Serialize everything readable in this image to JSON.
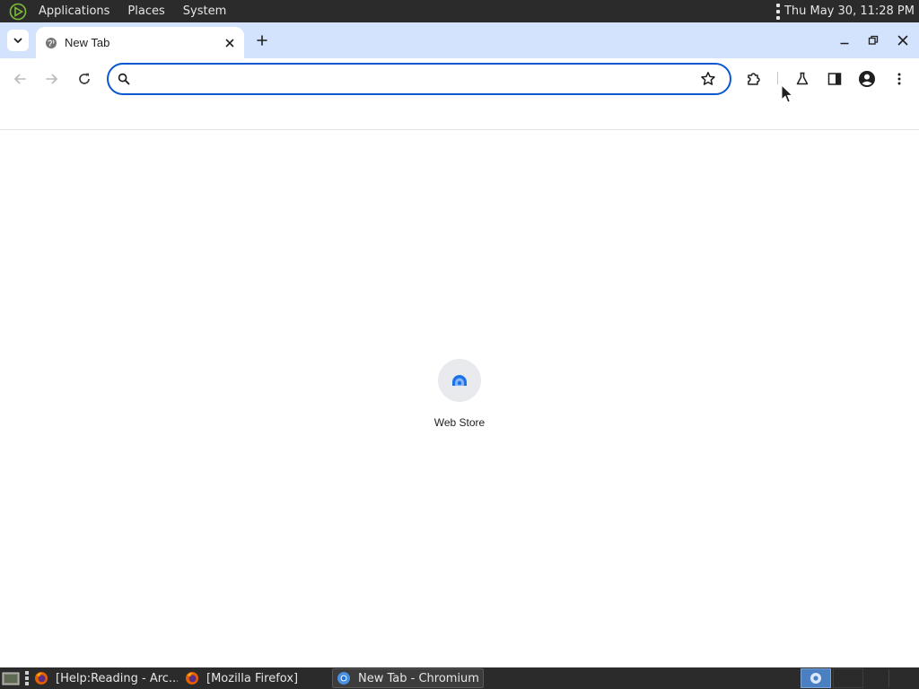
{
  "top_panel": {
    "menu": [
      "Applications",
      "Places",
      "System"
    ],
    "clock": "Thu May 30, 11:28 PM"
  },
  "browser": {
    "tab": {
      "title": "New Tab",
      "favicon": "globe-icon"
    },
    "omnibox": {
      "value": "",
      "placeholder": ""
    },
    "accent_color": "#0b57d0",
    "tabstrip_color": "#d3e3fd"
  },
  "content": {
    "shortcuts": [
      {
        "label": "Web Store",
        "icon": "web-store-icon"
      }
    ]
  },
  "taskbar": {
    "tasks": [
      {
        "label": "[Help:Reading - Arc...",
        "icon": "firefox-icon",
        "active": false
      },
      {
        "label": "[Mozilla Firefox]",
        "icon": "firefox-icon",
        "active": false
      },
      {
        "label": "New Tab - Chromium",
        "icon": "chromium-icon",
        "active": true
      }
    ]
  }
}
